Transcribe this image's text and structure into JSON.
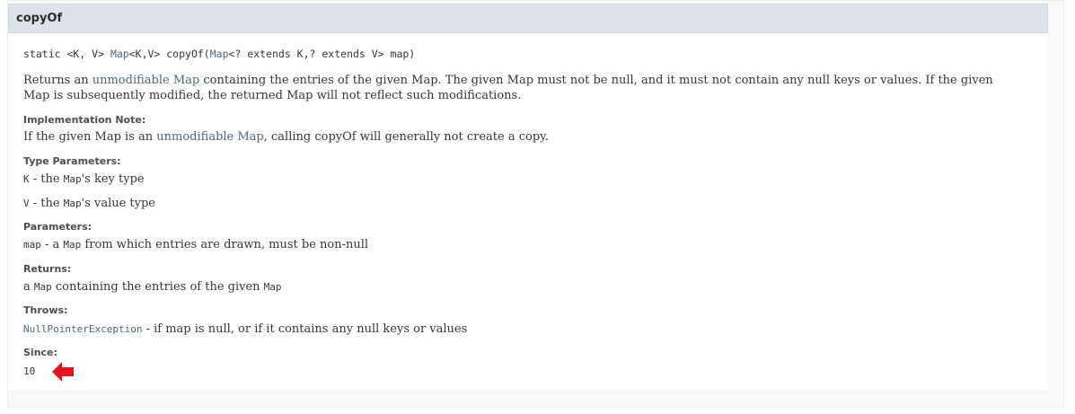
{
  "member": {
    "name": "copyOf",
    "signature": {
      "prefix": "static <K, V> ",
      "type_link": "Map",
      "type_rest": "<K,V> copyOf(",
      "param_link": "Map",
      "param_rest": "<? extends K,? extends V> map)"
    },
    "description": {
      "part1": "Returns an ",
      "link": "unmodifiable Map",
      "part2": " containing the entries of the given Map. The given Map must not be null, and it must not contain any null keys or values. If the given Map is subsequently modified, the returned Map will not reflect such modifications."
    },
    "impl_note": {
      "label": "Implementation Note:",
      "part1": "If the given Map is an ",
      "link": "unmodifiable Map",
      "part2": ", calling copyOf will generally not create a copy."
    },
    "type_params": {
      "label": "Type Parameters:",
      "k_code": "K",
      "k_text1": " - the ",
      "k_map": "Map",
      "k_text2": "'s key type",
      "v_code": "V",
      "v_text1": " - the ",
      "v_map": "Map",
      "v_text2": "'s value type"
    },
    "params": {
      "label": "Parameters:",
      "code": "map",
      "text1": " - a ",
      "map": "Map",
      "text2": " from which entries are drawn, must be non-null"
    },
    "returns": {
      "label": "Returns:",
      "text1": "a ",
      "map1": "Map",
      "text2": " containing the entries of the given ",
      "map2": "Map"
    },
    "throws": {
      "label": "Throws:",
      "exception": "NullPointerException",
      "text": " - if map is null, or if it contains any null keys or values"
    },
    "since": {
      "label": "Since:",
      "value": "10"
    }
  },
  "colors": {
    "link": "#4a6782",
    "header_bg": "#dee3e9",
    "arrow": "#e8141b"
  },
  "annotation": {
    "icon": "red-arrow-left-icon"
  }
}
